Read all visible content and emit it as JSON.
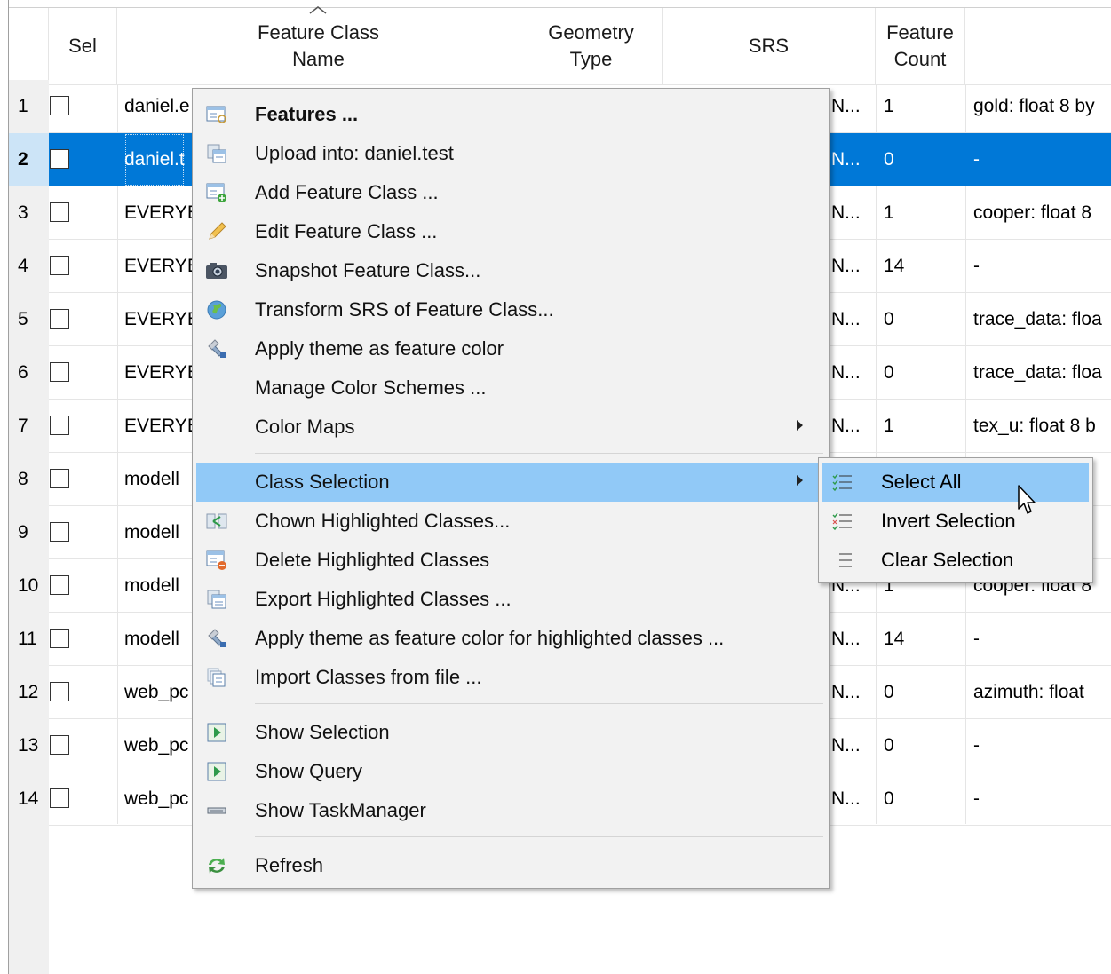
{
  "table": {
    "headers": {
      "sel": "Sel",
      "name": "Feature Class\nName",
      "geometry": "Geometry\nType",
      "srs": "SRS",
      "count": "Feature\nCount"
    },
    "rows": [
      {
        "num": "1",
        "name": "daniel.e",
        "srs": "N...",
        "count": "1",
        "attr": "gold: float 8 by"
      },
      {
        "num": "2",
        "name": "daniel.t",
        "srs": "N...",
        "count": "0",
        "attr": "-"
      },
      {
        "num": "3",
        "name": "EVERYE",
        "srs": "N...",
        "count": "1",
        "attr": "cooper: float 8"
      },
      {
        "num": "4",
        "name": "EVERYE",
        "srs": "N...",
        "count": "14",
        "attr": "-"
      },
      {
        "num": "5",
        "name": "EVERYE",
        "srs": "N...",
        "count": "0",
        "attr": "trace_data: floa"
      },
      {
        "num": "6",
        "name": "EVERYE",
        "srs": "N...",
        "count": "0",
        "attr": "trace_data: floa"
      },
      {
        "num": "7",
        "name": "EVERYE",
        "srs": "N...",
        "count": "1",
        "attr": "tex_u: float 8 b"
      },
      {
        "num": "8",
        "name": "modell",
        "srs": "",
        "count": "",
        "attr": ""
      },
      {
        "num": "9",
        "name": "modell",
        "srs": "",
        "count": "",
        "attr": ""
      },
      {
        "num": "10",
        "name": "modell",
        "srs": "N...",
        "count": "1",
        "attr": "cooper: float 8"
      },
      {
        "num": "11",
        "name": "modell",
        "srs": "N...",
        "count": "14",
        "attr": "-"
      },
      {
        "num": "12",
        "name": "web_pc",
        "srs": "N...",
        "count": "0",
        "attr": "azimuth: float"
      },
      {
        "num": "13",
        "name": "web_pc",
        "srs": "N...",
        "count": "0",
        "attr": "-"
      },
      {
        "num": "14",
        "name": "web_pc",
        "srs": "N...",
        "count": "0",
        "attr": "-"
      }
    ]
  },
  "context_menu": {
    "items": [
      {
        "label": "Features ...",
        "icon": "features-icon"
      },
      {
        "label": "Upload into: daniel.test",
        "icon": "upload-icon"
      },
      {
        "label": "Add Feature Class ...",
        "icon": "add-class-icon"
      },
      {
        "label": "Edit Feature Class ...",
        "icon": "pencil-icon"
      },
      {
        "label": "Snapshot Feature Class...",
        "icon": "camera-icon"
      },
      {
        "label": "Transform SRS of Feature Class...",
        "icon": "globe-icon"
      },
      {
        "label": "Apply theme as feature color",
        "icon": "paint-icon"
      },
      {
        "label": "Manage Color Schemes ...",
        "icon": ""
      },
      {
        "label": "Color Maps",
        "icon": ""
      },
      {
        "label": "Class Selection",
        "icon": ""
      },
      {
        "label": "Chown Highlighted Classes...",
        "icon": "chown-icon"
      },
      {
        "label": "Delete Highlighted Classes",
        "icon": "delete-class-icon"
      },
      {
        "label": "Export Highlighted Classes ...",
        "icon": "export-icon"
      },
      {
        "label": "Apply theme as feature color for highlighted classes ...",
        "icon": "paint-icon"
      },
      {
        "label": "Import Classes from file ...",
        "icon": "import-icon"
      },
      {
        "label": "Show Selection",
        "icon": "show-icon"
      },
      {
        "label": "Show Query",
        "icon": "show-icon"
      },
      {
        "label": "Show TaskManager",
        "icon": "taskmanager-icon"
      },
      {
        "label": "Refresh",
        "icon": "refresh-icon"
      }
    ]
  },
  "submenu": {
    "items": [
      {
        "label": "Select All",
        "icon": "select-all-icon"
      },
      {
        "label": "Invert Selection",
        "icon": "invert-selection-icon"
      },
      {
        "label": "Clear Selection",
        "icon": "clear-selection-icon"
      }
    ]
  },
  "colors": {
    "selection": "#0078d7",
    "menu_highlight": "#91c9f7",
    "menu_bg": "#f2f2f2"
  }
}
